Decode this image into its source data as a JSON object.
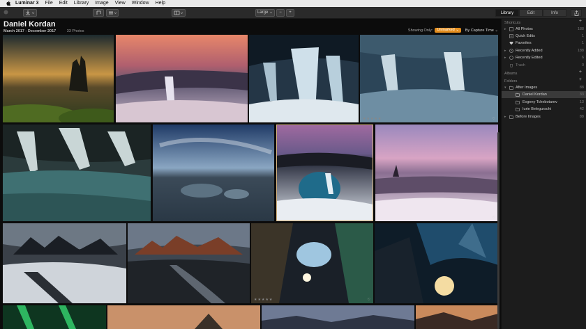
{
  "menubar": {
    "app": "Luminar 3",
    "items": [
      "File",
      "Edit",
      "Library",
      "Image",
      "View",
      "Window",
      "Help"
    ]
  },
  "toolbar": {
    "size_label": "Large",
    "zoom_out": "−",
    "zoom_in": "+",
    "tabs": [
      "Library",
      "Edit",
      "Info"
    ]
  },
  "gallery": {
    "title": "Daniel Kordan",
    "date_range": "March 2017 - December 2017",
    "count": "33 Photos",
    "showing_label": "Showing Only:",
    "filter": "Unmarked",
    "sort": "By Capture Time",
    "stars": "★★★★★",
    "heart": "♡"
  },
  "sidebar": {
    "shortcuts_label": "Shortcuts",
    "shortcuts": [
      {
        "label": "All Photos",
        "count": "188"
      },
      {
        "label": "Quick Edits",
        "count": "1"
      },
      {
        "label": "Favorites",
        "count": "1"
      },
      {
        "label": "Recently Added",
        "count": "188"
      },
      {
        "label": "Recently Edited",
        "count": "6"
      },
      {
        "label": "Trash",
        "count": "0"
      }
    ],
    "albums_label": "Albums",
    "folders_label": "Folders",
    "folders": [
      {
        "label": "After Images",
        "count": "88"
      },
      {
        "label": "Daniel Kordan",
        "count": "33"
      },
      {
        "label": "Evgeny Tchebotarev",
        "count": "13"
      },
      {
        "label": "Iurie Belegurschi",
        "count": "42"
      },
      {
        "label": "Before Images",
        "count": "88"
      }
    ],
    "plus": "+"
  },
  "colors": {
    "accent": "#e48e1e",
    "selection": "#d8b680"
  }
}
